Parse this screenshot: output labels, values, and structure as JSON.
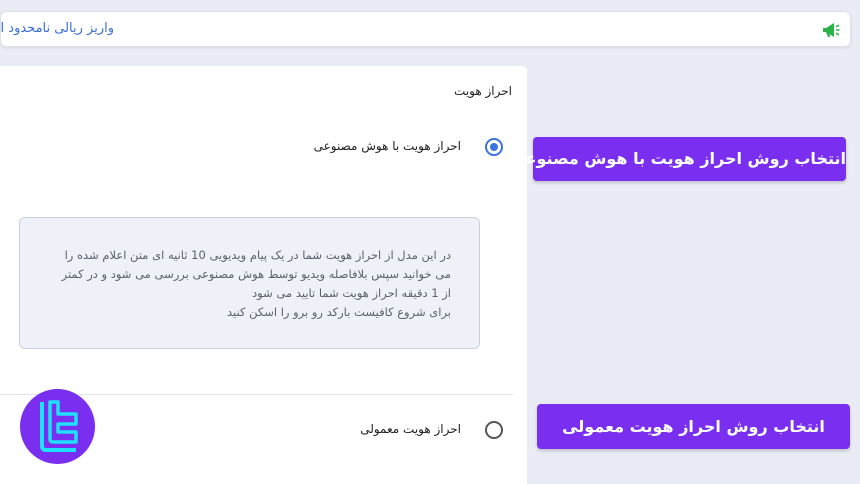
{
  "announcement": {
    "text": "واریز ریالی نامحدود از",
    "icon": "megaphone-icon",
    "icon_color": "#2bb34a",
    "text_color": "#3b6fd6"
  },
  "identity": {
    "section_title": "احراز هویت",
    "options": [
      {
        "label": "احراز هویت با هوش مصنوعی",
        "selected": true
      },
      {
        "label": "احراز هویت معمولی",
        "selected": false
      }
    ],
    "info_lines": [
      "در این مدل از احراز هویت شما در یک پیام ویدیویی 10 ثانیه ای متن اعلام شده را",
      "می خوانید سپس بلافاصله ویدیو توسط هوش مصنوعی بررسی می شود و در کمتر",
      "از 1 دقیقه احراز هویت شما تایید می شود",
      "برای شروع کافیست بارکد رو برو را اسکن کنید"
    ]
  },
  "callouts": {
    "ai": "انتخاب روش احراز هویت با هوش مصنوعی",
    "normal": "انتخاب روش احراز هویت معمولی"
  },
  "colors": {
    "accent": "#7a2ff0",
    "radio_selected": "#3b73e0",
    "logo_mark": "#1ee0ff",
    "background": "#e9ecf4"
  },
  "logo": {
    "icon": "tradingfinder-logo-icon"
  }
}
